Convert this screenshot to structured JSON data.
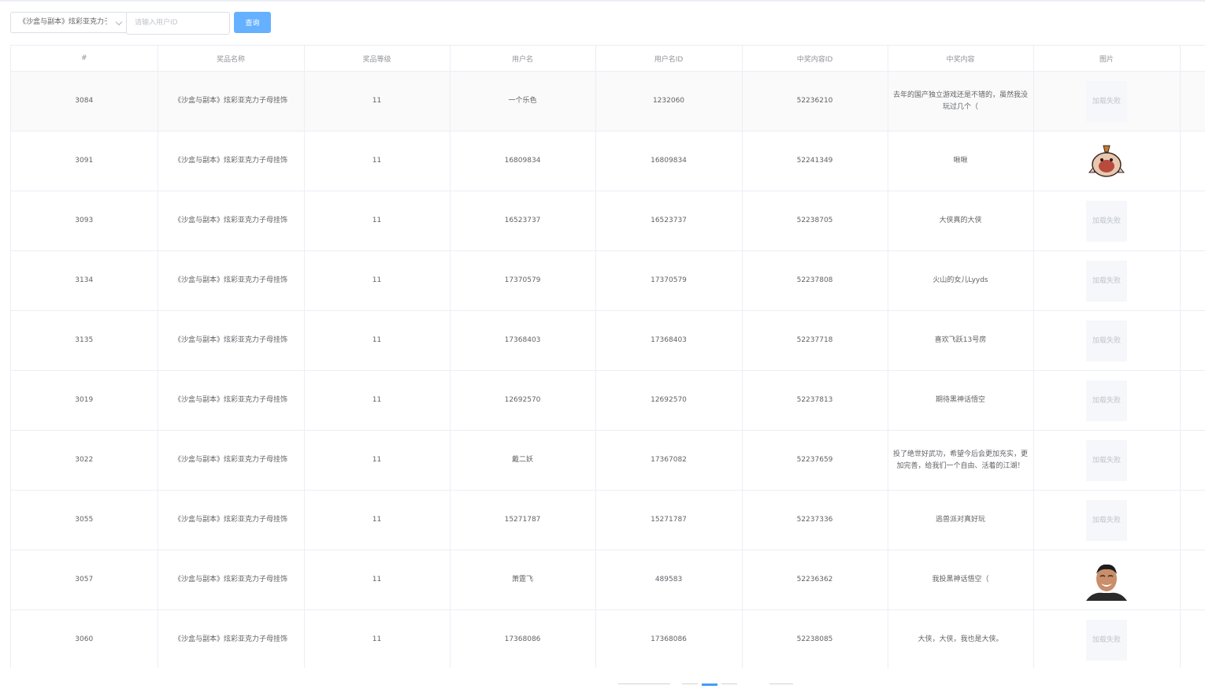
{
  "filter": {
    "select_value": "《沙盒与副本》炫彩亚克力子母挂饰",
    "input_placeholder": "请输入用户ID",
    "query_label": "查询"
  },
  "table": {
    "headers": [
      "#",
      "奖品名称",
      "奖品等级",
      "用户名",
      "用户名ID",
      "中奖内容ID",
      "中奖内容",
      "图片",
      ""
    ],
    "rows": [
      {
        "id": "3084",
        "prize": "《沙盒与副本》炫彩亚克力子母挂饰",
        "level": "11",
        "user": "一个乐色",
        "user_id": "1232060",
        "content_id": "52236210",
        "content": "去年的国产独立游戏还是不错的，虽然我没玩过几个（",
        "image": "加载失败",
        "image_type": "failed"
      },
      {
        "id": "3091",
        "prize": "《沙盒与副本》炫彩亚克力子母挂饰",
        "level": "11",
        "user": "16809834",
        "user_id": "16809834",
        "content_id": "52241349",
        "content": "啾啾",
        "image": "",
        "image_type": "creature-avatar"
      },
      {
        "id": "3093",
        "prize": "《沙盒与副本》炫彩亚克力子母挂饰",
        "level": "11",
        "user": "16523737",
        "user_id": "16523737",
        "content_id": "52238705",
        "content": "大侠真的大侠",
        "image": "加载失败",
        "image_type": "failed"
      },
      {
        "id": "3134",
        "prize": "《沙盒与副本》炫彩亚克力子母挂饰",
        "level": "11",
        "user": "17370579",
        "user_id": "17370579",
        "content_id": "52237808",
        "content": "火山的女儿Lyyds",
        "image": "加载失败",
        "image_type": "failed"
      },
      {
        "id": "3135",
        "prize": "《沙盒与副本》炫彩亚克力子母挂饰",
        "level": "11",
        "user": "17368403",
        "user_id": "17368403",
        "content_id": "52237718",
        "content": "喜欢飞跃13号房",
        "image": "加载失败",
        "image_type": "failed"
      },
      {
        "id": "3019",
        "prize": "《沙盒与副本》炫彩亚克力子母挂饰",
        "level": "11",
        "user": "12692570",
        "user_id": "12692570",
        "content_id": "52237813",
        "content": "期待黑神话悟空",
        "image": "加载失败",
        "image_type": "failed"
      },
      {
        "id": "3022",
        "prize": "《沙盒与副本》炫彩亚克力子母挂饰",
        "level": "11",
        "user": "戴二妖",
        "user_id": "17367082",
        "content_id": "52237659",
        "content": "投了绝世好武功，希望今后会更加充实，更加完善，给我们一个自由、活着的江湖！",
        "image": "加载失败",
        "image_type": "failed"
      },
      {
        "id": "3055",
        "prize": "《沙盒与副本》炫彩亚克力子母挂饰",
        "level": "11",
        "user": "15271787",
        "user_id": "15271787",
        "content_id": "52237336",
        "content": "逃兽派对真好玩",
        "image": "加载失败",
        "image_type": "failed"
      },
      {
        "id": "3057",
        "prize": "《沙盒与副本》炫彩亚克力子母挂饰",
        "level": "11",
        "user": "萧霆飞",
        "user_id": "489583",
        "content_id": "52236362",
        "content": "我投黑神话悟空（",
        "image": "",
        "image_type": "face-avatar"
      },
      {
        "id": "3060",
        "prize": "《沙盒与副本》炫彩亚克力子母挂饰",
        "level": "11",
        "user": "17368086",
        "user_id": "17368086",
        "content_id": "52238085",
        "content": "大侠，大侠，我也是大侠。",
        "image": "加载失败",
        "image_type": "failed"
      }
    ]
  },
  "colors": {
    "accent": "#409eff",
    "button": "#66b1ff",
    "border": "#ebeef5",
    "text": "#606266"
  }
}
